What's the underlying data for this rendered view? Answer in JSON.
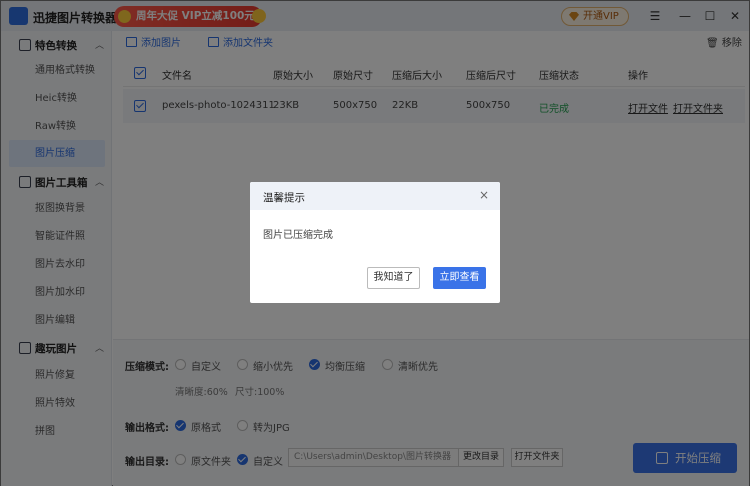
{
  "app": {
    "title": "迅捷图片转换器",
    "promo": "周年大促 VIP立减100元",
    "vip_label": "开通VIP"
  },
  "window_controls": {
    "menu": "☰",
    "minimize": "—",
    "maximize": "☐",
    "close": "✕"
  },
  "sidebar": {
    "sections": [
      {
        "label": "特色转换",
        "chevron": "︿",
        "items": [
          "通用格式转换",
          "Heic转换",
          "Raw转换",
          "图片压缩"
        ]
      },
      {
        "label": "图片工具箱",
        "chevron": "︿",
        "items": [
          "抠图换背景",
          "智能证件照",
          "图片去水印",
          "图片加水印",
          "图片编辑"
        ]
      },
      {
        "label": "趣玩图片",
        "chevron": "︿",
        "items": [
          "照片修复",
          "照片特效",
          "拼图"
        ]
      }
    ],
    "active_item": "图片压缩"
  },
  "toolbar": {
    "add_image": "添加图片",
    "add_folder": "添加文件夹",
    "remove": "移除"
  },
  "table": {
    "columns": [
      "文件名",
      "原始大小",
      "原始尺寸",
      "压缩后大小",
      "压缩后尺寸",
      "压缩状态",
      "操作"
    ],
    "rows": [
      {
        "name": "pexels-photo-1024311",
        "orig_size": "23KB",
        "orig_dim": "500x750",
        "new_size": "22KB",
        "new_dim": "500x750",
        "status": "已完成",
        "open_file": "打开文件",
        "open_folder": "打开文件夹"
      }
    ]
  },
  "options": {
    "mode_label": "压缩模式:",
    "modes": [
      "自定义",
      "缩小优先",
      "均衡压缩",
      "清晰优先"
    ],
    "selected_mode": "均衡压缩",
    "clarity": "清晰度:60%",
    "size": "尺寸:100%",
    "format_label": "输出格式:",
    "formats": [
      "原格式",
      "转为JPG"
    ],
    "selected_format": "原格式",
    "dir_label": "输出目录:",
    "dirs": [
      "原文件夹",
      "自定义"
    ],
    "selected_dir": "自定义",
    "path": "C:\\Users\\admin\\Desktop\\图片转换器",
    "change_dir": "更改目录",
    "open_folder": "打开文件夹",
    "start": "开始压缩"
  },
  "dialog": {
    "title": "温馨提示",
    "message": "图片已压缩完成",
    "ok": "我知道了",
    "view": "立即查看",
    "close": "×"
  },
  "colors": {
    "accent": "#3a73e8",
    "success": "#22a050",
    "promo": "#e83a30"
  }
}
